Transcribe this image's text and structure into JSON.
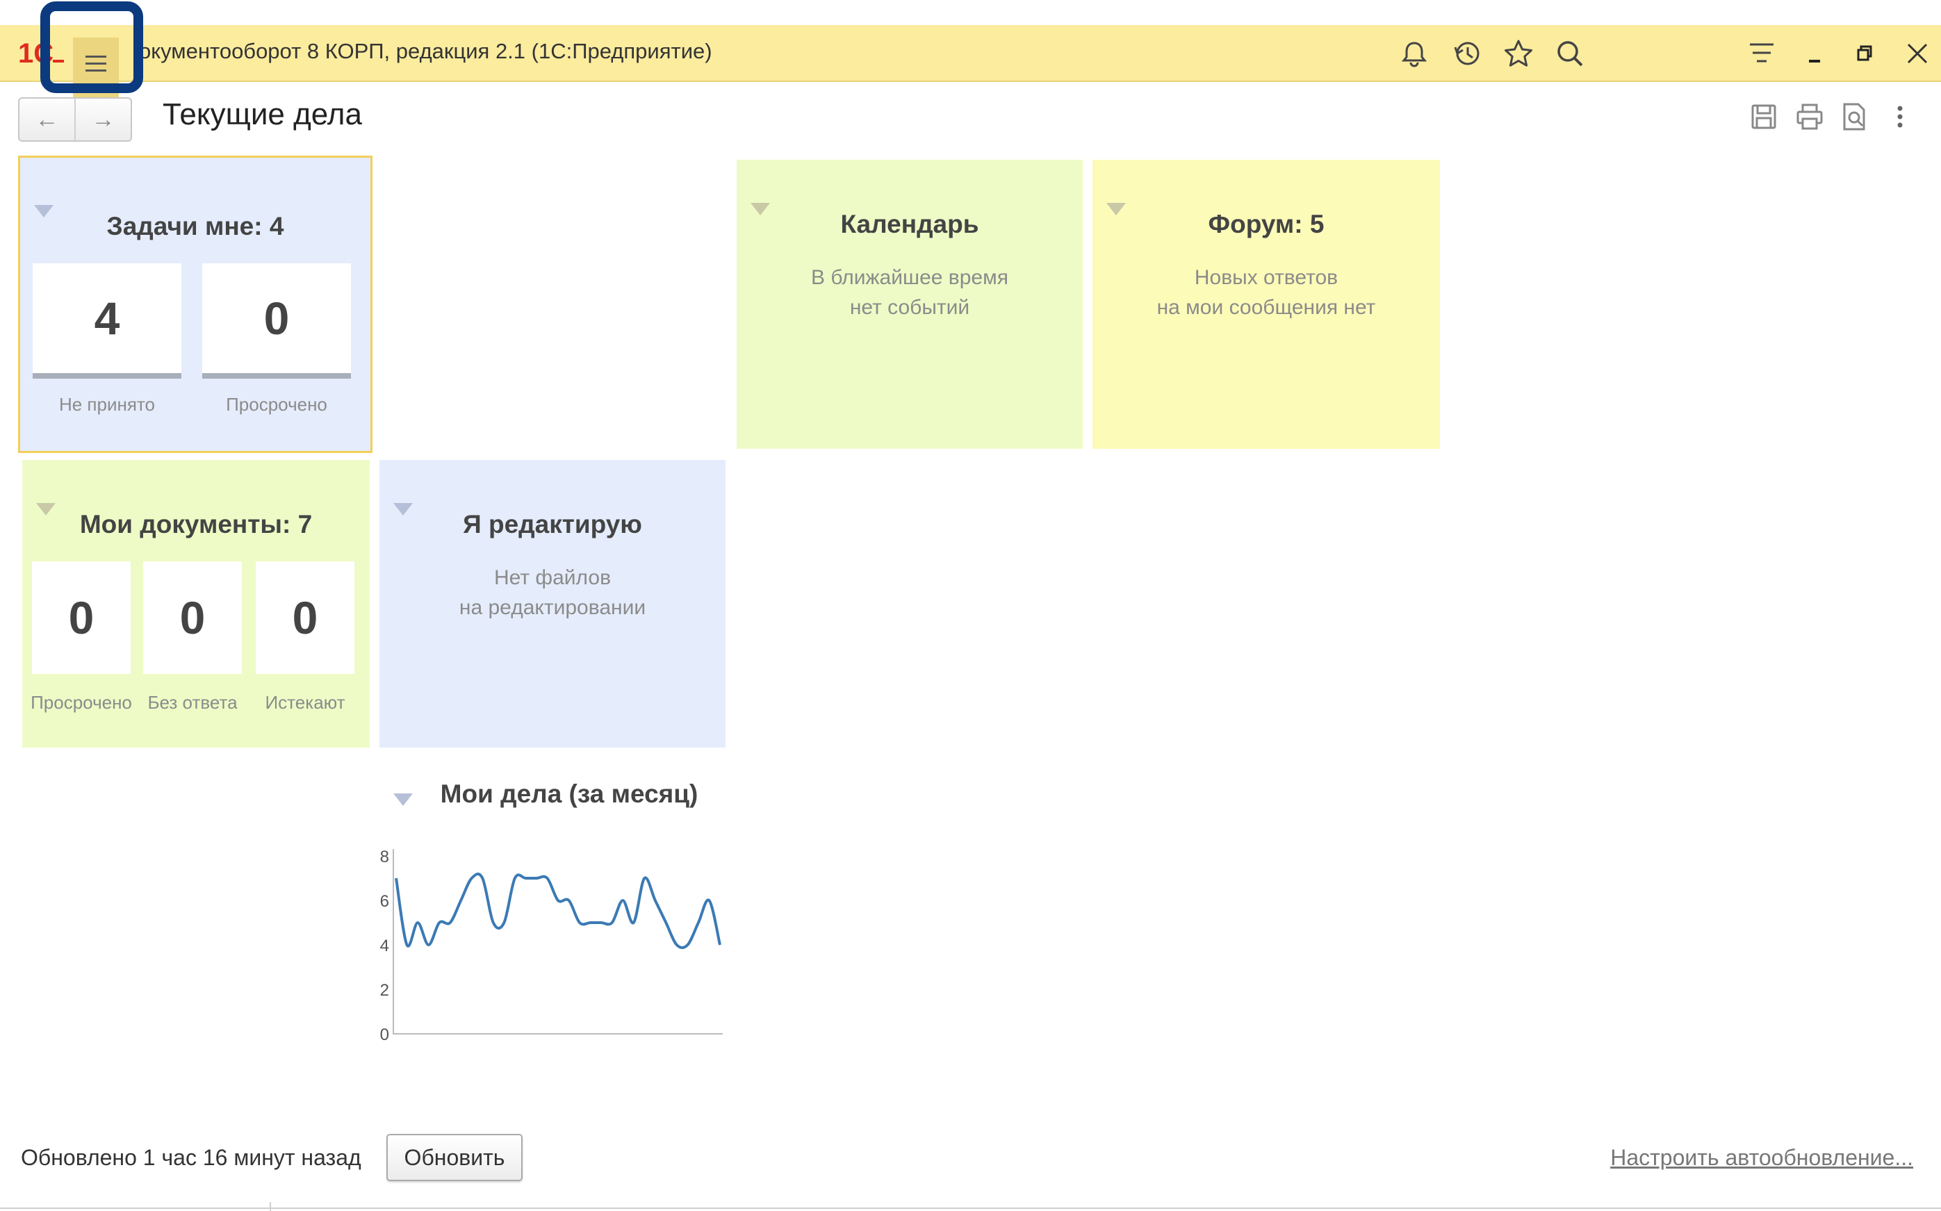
{
  "titlebar": {
    "logo_text": "1С",
    "title": "окументооборот 8 КОРП, редакция 2.1  (1С:Предприятие)",
    "menu_icon": "hamburger-icon",
    "icons": [
      "bell-icon",
      "history-icon",
      "star-icon",
      "search-icon",
      "more-menu-icon",
      "minimize-icon",
      "restore-icon",
      "close-icon"
    ]
  },
  "header": {
    "back_label": "←",
    "forward_label": "→",
    "title": "Текущие дела",
    "tools": [
      "save-icon",
      "print-icon",
      "preview-icon",
      "more-vertical-icon"
    ]
  },
  "tiles": {
    "tasks": {
      "title": "Задачи мне: 4",
      "items": [
        {
          "value": "4",
          "label": "Не принято"
        },
        {
          "value": "0",
          "label": "Просрочено"
        }
      ]
    },
    "calendar": {
      "title": "Календарь",
      "line1": "В ближайшее время",
      "line2": "нет событий"
    },
    "forum": {
      "title": "Форум: 5",
      "line1": "Новых ответов",
      "line2": "на мои сообщения нет"
    },
    "documents": {
      "title": "Мои документы: 7",
      "items": [
        {
          "value": "0",
          "label": "Просрочено"
        },
        {
          "value": "0",
          "label": "Без ответа"
        },
        {
          "value": "0",
          "label": "Истекают"
        }
      ]
    },
    "editing": {
      "title": "Я редактирую",
      "line1": "Нет файлов",
      "line2": "на редактировании"
    },
    "affairs": {
      "title": "Мои дела (за месяц)"
    }
  },
  "chart_data": {
    "type": "line",
    "title": "Мои дела (за месяц)",
    "ylim": [
      0,
      8
    ],
    "yticks": [
      "0",
      "2",
      "4",
      "6",
      "8"
    ],
    "series": [
      {
        "color": "#3b7ab4",
        "values": [
          7,
          4,
          5,
          4,
          5,
          5,
          6,
          7,
          7,
          5,
          5,
          7,
          7,
          7,
          7,
          6,
          6,
          5,
          5,
          5,
          5,
          6,
          5,
          7,
          6,
          5,
          4,
          4,
          5,
          6,
          4
        ]
      }
    ],
    "grid": false
  },
  "footer": {
    "updated": "Обновлено 1 час 16 минут назад",
    "refresh_label": "Обновить",
    "auto_link": "Настроить автообновление..."
  },
  "colors": {
    "titlebar": "#fbec9e",
    "highlight": "#0b3a7e",
    "tile_blue": "#e5ecfb",
    "tile_green": "#eefbc6",
    "tile_yellow": "#fcfbb8",
    "line": "#3b7ab4"
  }
}
